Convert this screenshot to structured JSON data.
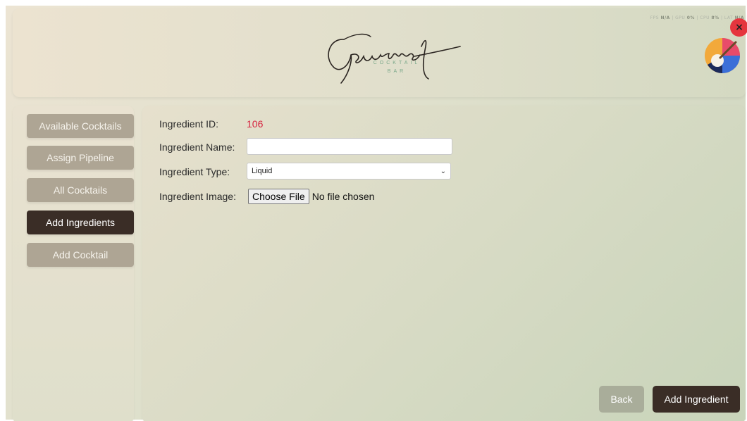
{
  "header": {
    "logo_subtitle_line1": "COCKTAIL",
    "logo_subtitle_line2": "BAR",
    "logo_script_text": "Gourmet",
    "perf": {
      "fps_label": "FPS",
      "fps_value": "N/A",
      "gpu_label": "GPU",
      "gpu_value": "0%",
      "cpu_label": "CPU",
      "cpu_value": "8%",
      "lat_label": "LAT",
      "lat_value": "N/A"
    },
    "close_icon": "close-icon",
    "close_symbol": "×"
  },
  "sidebar": {
    "items": [
      {
        "label": "Available Cocktails",
        "active": false
      },
      {
        "label": "Assign Pipeline",
        "active": false
      },
      {
        "label": "All Cocktails",
        "active": false
      },
      {
        "label": "Add Ingredients",
        "active": true
      },
      {
        "label": "Add Cocktail",
        "active": false
      }
    ]
  },
  "form": {
    "id_label": "Ingredient ID:",
    "id_value": "106",
    "name_label": "Ingredient Name:",
    "name_value": "",
    "type_label": "Ingredient Type:",
    "type_value": "Liquid",
    "image_label": "Ingredient Image:",
    "file_button": "Choose File",
    "file_status": "No file chosen"
  },
  "actions": {
    "back_label": "Back",
    "add_label": "Add Ingredient"
  },
  "colors": {
    "active_nav": "#3a2d26",
    "inactive_nav": "#aea594",
    "id_value": "#d6233f",
    "close": "#e5353e"
  }
}
